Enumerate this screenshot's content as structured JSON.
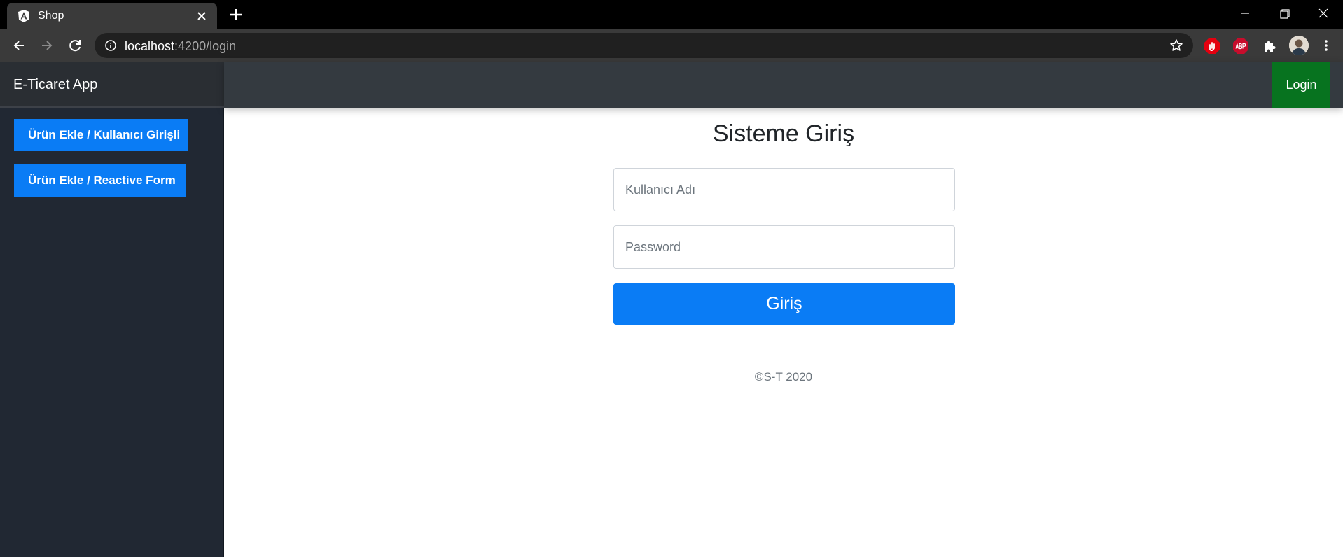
{
  "browser": {
    "tab_title": "Shop",
    "url_host": "localhost",
    "url_path": ":4200/login",
    "icons": [
      "angular-icon",
      "close-icon",
      "plus-icon",
      "minimize-icon",
      "restore-icon",
      "close-icon",
      "back-arrow-icon",
      "forward-arrow-icon",
      "reload-icon",
      "info-icon",
      "star-icon",
      "adblock-hand-icon",
      "abp-icon",
      "puzzle-icon",
      "avatar",
      "more-vert-icon"
    ]
  },
  "app": {
    "brand": "E-Ticaret App",
    "sidebar": {
      "items": [
        {
          "label": "Ürün Ekle / Kullanıcı Girişli"
        },
        {
          "label": "Ürün Ekle / Reactive Form"
        }
      ]
    },
    "topnav": {
      "login_label": "Login"
    },
    "login_form": {
      "title": "Sisteme Giriş",
      "username_placeholder": "Kullanıcı Adı",
      "password_placeholder": "Password",
      "submit_label": "Giriş"
    },
    "footer": "©S-T 2020"
  },
  "colors": {
    "primary": "#0a7cf5",
    "success": "#07731f",
    "sidebar": "#212833",
    "navbar": "#343a40"
  }
}
